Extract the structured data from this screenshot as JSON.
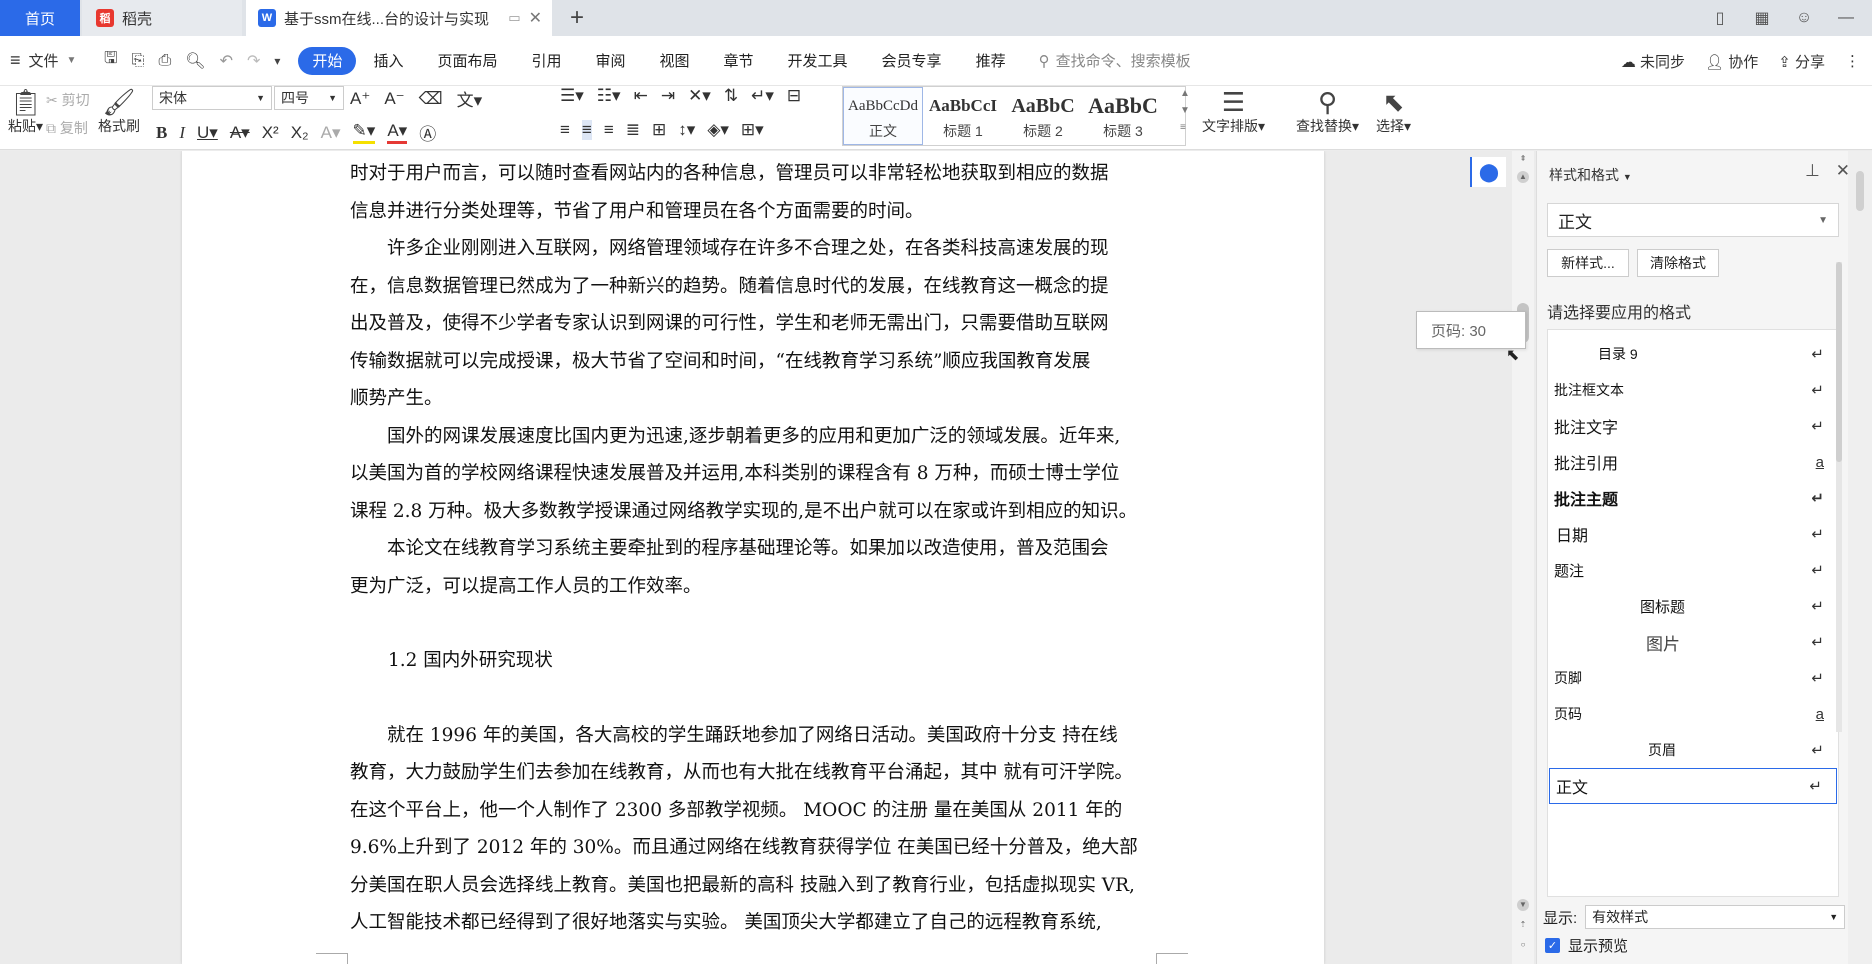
{
  "tabs": {
    "home": "首页",
    "daoke": "稻壳",
    "doc": "基于ssm在线...台的设计与实现",
    "add": "+"
  },
  "menu": {
    "file": "文件",
    "tabs": [
      "开始",
      "插入",
      "页面布局",
      "引用",
      "审阅",
      "视图",
      "章节",
      "开发工具",
      "会员专享",
      "推荐"
    ],
    "search_placeholder": "查找命令、搜索模板",
    "sync": "未同步",
    "collab": "协作",
    "share": "分享"
  },
  "ribbon": {
    "paste": "粘贴",
    "cut": "剪切",
    "copy": "复制",
    "format_painter": "格式刷",
    "font_name": "宋体",
    "font_size": "四号",
    "styles": [
      {
        "preview": "AaBbCcDd",
        "name": "正文"
      },
      {
        "preview": "AaBbCcI",
        "name": "标题 1"
      },
      {
        "preview": "AaBbC",
        "name": "标题 2"
      },
      {
        "preview": "AaBbC",
        "name": "标题 3"
      }
    ],
    "text_layout": "文字排版",
    "find_replace": "查找替换",
    "select": "选择"
  },
  "document": {
    "para1": [
      "时对于用户而言，可以随时查看网站内的各种信息，管理员可以非常轻松地获取到相应的数据",
      "信息并进行分类处理等，节省了用户和管理员在各个方面需要的时间。"
    ],
    "para2": [
      "许多企业刚刚进入互联网，网络管理领域存在许多不合理之处，在各类科技高速发展的现",
      "在，信息数据管理已然成为了一种新兴的趋势。随着信息时代的发展，在线教育这一概念的提",
      "出及普及，使得不少学者专家认识到网课的可行性，学生和老师无需出门，只需要借助互联网",
      "传输数据就可以完成授课，极大节省了空间和时间，“在线教育学习系统”顺应我国教育发展",
      "顺势产生。"
    ],
    "para3": [
      "国外的网课发展速度比国内更为迅速,逐步朝着更多的应用和更加广泛的领域发展。近年来,",
      "以美国为首的学校网络课程快速发展普及并运用,本科类别的课程含有 8 万种，而硕士博士学位",
      "课程 2.8 万种。极大多数教学授课通过网络教学实现的,是不出户就可以在家或许到相应的知识。"
    ],
    "para4": [
      "本论文在线教育学习系统主要牵扯到的程序基础理论等。如果加以改造使用，普及范围会",
      "更为广泛，可以提高工作人员的工作效率。"
    ],
    "heading": "1.2  国内外研究现状",
    "para5": [
      "就在 1996 年的美国，各大高校的学生踊跃地参加了网络日活动。美国政府十分支 持在线",
      "教育，大力鼓励学生们去参加在线教育，从而也有大批在线教育平台涌起，其中 就有可汗学院。",
      "在这个平台上，他一个人制作了 2300 多部教学视频。 MOOC 的注册 量在美国从 2011 年的",
      "9.6%上升到了 2012 年的 30%。而且通过网络在线教育获得学位 在美国已经十分普及，绝大部",
      "分美国在职人员会选择线上教育。美国也把最新的高科 技融入到了教育行业，包括虚拟现实 VR,",
      "人工智能技术都已经得到了很好地落实与实验。 美国顶尖大学都建立了自己的远程教育系统,"
    ],
    "page_tooltip": "页码: 30"
  },
  "panel": {
    "title": "样式和格式",
    "current_style": "正文",
    "new_style": "新样式...",
    "clear_format": "清除格式",
    "choose_label": "请选择要应用的格式",
    "styles": [
      {
        "name": "目录 9",
        "mark": "↵"
      },
      {
        "name": "批注框文本",
        "mark": "↵"
      },
      {
        "name": "批注文字",
        "mark": "↵"
      },
      {
        "name": "批注引用",
        "mark": "a"
      },
      {
        "name": "批注主题",
        "mark": "↵"
      },
      {
        "name": "日期",
        "mark": "↵"
      },
      {
        "name": "题注",
        "mark": "↵"
      },
      {
        "name": "图标题",
        "mark": "↵"
      },
      {
        "name": "图片",
        "mark": "↵"
      },
      {
        "name": "页脚",
        "mark": "↵"
      },
      {
        "name": "页码",
        "mark": "a"
      },
      {
        "name": "页眉",
        "mark": "↵"
      },
      {
        "name": "正文",
        "mark": "↵"
      }
    ],
    "show_label": "显示:",
    "show_value": "有效样式",
    "preview_label": "显示预览"
  },
  "colors": {
    "accent": "#2b6ae8",
    "daoke_icon": "#e8382f",
    "doc_icon": "#2b6ae8"
  }
}
